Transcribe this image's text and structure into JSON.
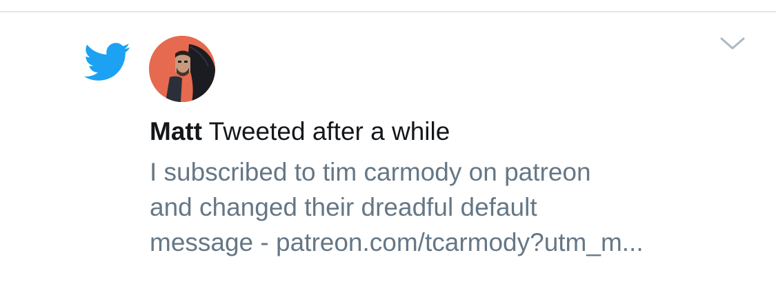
{
  "notification": {
    "app_icon": "twitter-bird-icon",
    "menu_icon": "chevron-down-icon",
    "user_name": "Matt",
    "action_text": "Tweeted after a while",
    "tweet_lines": [
      "I subscribed to tim carmody on patreon",
      "and changed their dreadful default",
      "message - patreon.com/tcarmody?utm_m..."
    ]
  },
  "colors": {
    "twitter_blue": "#1da1f2",
    "primary_text": "#14171a",
    "secondary_text": "#657786",
    "divider": "#e1e8ed",
    "avatar_background": "#e56a4f"
  }
}
